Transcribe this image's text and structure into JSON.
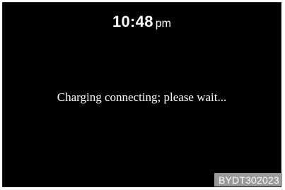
{
  "status_bar": {
    "time": "10:48",
    "ampm": "pm"
  },
  "screen": {
    "message": "Charging connecting; please wait..."
  },
  "figure": {
    "code": "BYDT302023"
  },
  "colors": {
    "screen_background": "#000000",
    "text": "#ffffff",
    "code_tag_background": "#9a9a9a"
  }
}
